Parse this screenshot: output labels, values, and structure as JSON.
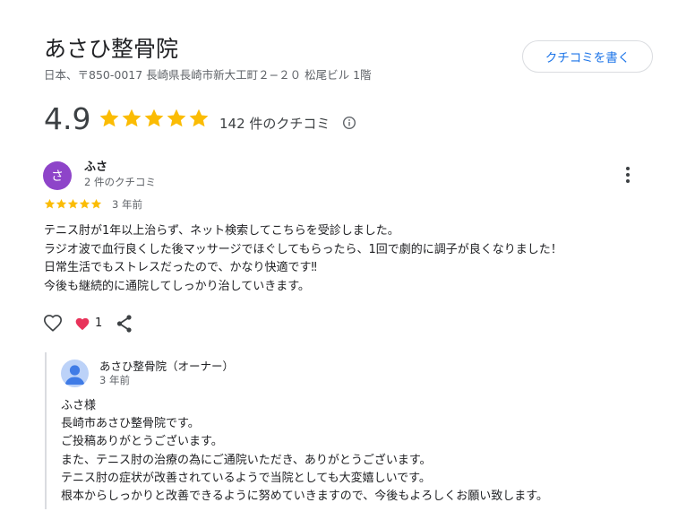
{
  "place": {
    "name": "あさひ整骨院",
    "address": "日本、〒850-0017 長崎県長崎市新大工町２−２０ 松尾ビル 1階",
    "write_review_label": "クチコミを書く"
  },
  "summary": {
    "rating": "4.9",
    "stars": 5,
    "review_count": "142 件のクチコミ",
    "star_color": "#fbbc04"
  },
  "review": {
    "avatar_letter": "さ",
    "avatar_color": "#8e44c9",
    "author": "ふさ",
    "author_review_count": "2 件のクチコミ",
    "stars": 5,
    "time": "3 年前",
    "lines": [
      "テニス肘が1年以上治らず、ネット検索してこちらを受診しました。",
      "ラジオ波で血行良くした後マッサージでほぐしてもらったら、1回で劇的に調子が良くなりました！",
      "日常生活でもストレスだったので、かなり快適です‼",
      "今後も継続的に通院してしっかり治していきます。"
    ],
    "reaction_count": "1",
    "icons": [
      "like-icon",
      "heart-reaction-icon",
      "share-icon",
      "more-options-icon"
    ]
  },
  "owner_reply": {
    "name": "あさひ整骨院（オーナー）",
    "time": "3 年前",
    "lines": [
      "ふさ様",
      "長崎市あさひ整骨院です。",
      "ご投稿ありがとうございます。",
      "また、テニス肘の治療の為にご通院いただき、ありがとうございます。",
      "テニス肘の症状が改善されているようで当院としても大変嬉しいです。",
      "根本からしっかりと改善できるように努めていきますので、今後もよろしくお願い致します。"
    ]
  }
}
